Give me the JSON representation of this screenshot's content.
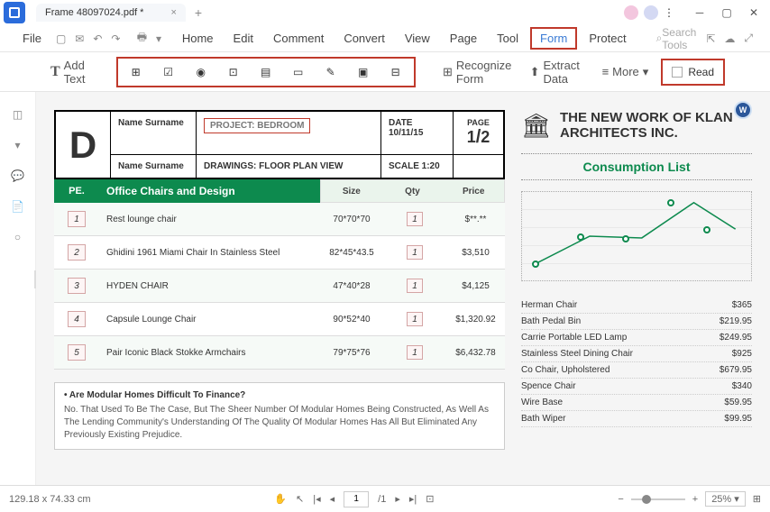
{
  "titlebar": {
    "tab_name": "Frame 48097024.pdf *"
  },
  "menu": {
    "file": "File",
    "home": "Home",
    "edit": "Edit",
    "comment": "Comment",
    "convert": "Convert",
    "view": "View",
    "page": "Page",
    "tool": "Tool",
    "form": "Form",
    "protect": "Protect",
    "search_placeholder": "Search Tools"
  },
  "toolbar": {
    "add_text": "Add Text",
    "recognize_form": "Recognize Form",
    "extract_data": "Extract Data",
    "more_label": "More",
    "read_label": "Read"
  },
  "doc": {
    "name1": "Name Surname",
    "name2": "Name Surname",
    "project_label": "PROJECT: BEDROOM",
    "drawings_label": "DRAWINGS: FLOOR PLAN VIEW",
    "date_label": "DATE 10/11/15",
    "scale_label": "SCALE 1:20",
    "page_label": "PAGE",
    "page_frac_1": "1",
    "page_frac_2": "2",
    "table_header": {
      "pe": "PE.",
      "name": "Office Chairs and Design",
      "size": "Size",
      "qty": "Qty",
      "price": "Price"
    },
    "rows": [
      {
        "pe": "1",
        "name": "Rest lounge chair",
        "size": "70*70*70",
        "qty": "1",
        "price": "$**.**"
      },
      {
        "pe": "2",
        "name": "Ghidini 1961 Miami Chair In Stainless Steel",
        "size": "82*45*43.5",
        "qty": "1",
        "price": "$3,510"
      },
      {
        "pe": "3",
        "name": "HYDEN CHAIR",
        "size": "47*40*28",
        "qty": "1",
        "price": "$4,125"
      },
      {
        "pe": "4",
        "name": "Capsule Lounge Chair",
        "size": "90*52*40",
        "qty": "1",
        "price": "$1,320.92"
      },
      {
        "pe": "5",
        "name": "Pair Iconic Black Stokke Armchairs",
        "size": "79*75*76",
        "qty": "1",
        "price": "$6,432.78"
      }
    ],
    "faq_q": "• Are Modular Homes Difficult To Finance?",
    "faq_a": "No. That Used To Be The Case, But The Sheer Number Of Modular Homes Being Constructed, As Well As The Lending Community's Understanding Of The Quality Of Modular Homes Has All But Eliminated Any Previously Existing Prejudice."
  },
  "sidebar_doc": {
    "company": "THE NEW WORK OF KLAN ARCHITECTS INC.",
    "consumption_title": "Consumption List",
    "items": [
      {
        "name": "Herman Chair",
        "price": "$365"
      },
      {
        "name": "Bath Pedal Bin",
        "price": "$219.95"
      },
      {
        "name": "Carrie Portable LED Lamp",
        "price": "$249.95"
      },
      {
        "name": "Stainless Steel Dining Chair",
        "price": "$925"
      },
      {
        "name": "Co Chair, Upholstered",
        "price": "$679.95"
      },
      {
        "name": "Spence Chair",
        "price": "$340"
      },
      {
        "name": "Wire Base",
        "price": "$59.95"
      },
      {
        "name": "Bath Wiper",
        "price": "$99.95"
      }
    ]
  },
  "chart_data": {
    "type": "line",
    "x": [
      1,
      2,
      3,
      4,
      5
    ],
    "values": [
      20,
      50,
      48,
      88,
      58
    ],
    "ylim": [
      0,
      100
    ]
  },
  "statusbar": {
    "dimensions": "129.18 x 74.33 cm",
    "page_current": "1",
    "page_total": "/1",
    "zoom": "25%"
  }
}
